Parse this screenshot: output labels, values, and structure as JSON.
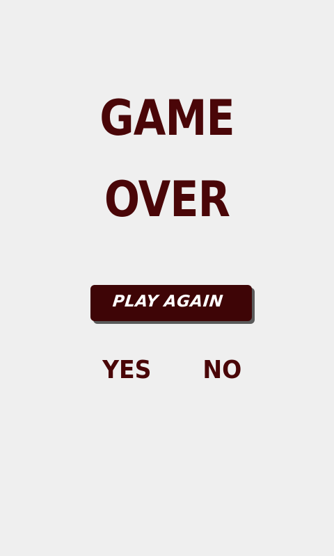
{
  "title": {
    "line1": "GAME",
    "line2": "OVER"
  },
  "play_again": {
    "label": "PLAY AGAIN"
  },
  "choices": {
    "yes": "YES",
    "no": "NO"
  },
  "colors": {
    "background": "#efefef",
    "accent": "#4a0608",
    "button_bg": "#3e0506",
    "button_text": "#ffffff"
  }
}
